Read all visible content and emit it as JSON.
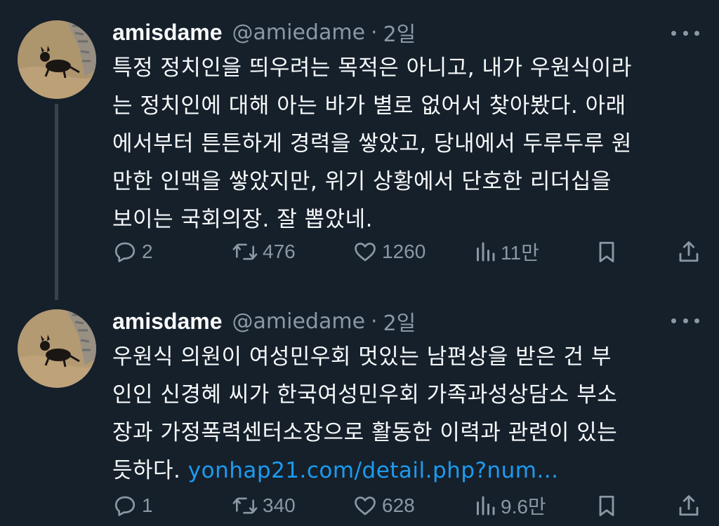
{
  "colors": {
    "background": "#15202b",
    "text": "#f7f9f9",
    "muted": "#8b98a5",
    "link": "#1d9bf0",
    "thread_line": "#38444d"
  },
  "icons": {
    "reply": "reply-icon",
    "retweet": "retweet-icon",
    "like": "heart-icon",
    "views": "views-icon",
    "bookmark": "bookmark-icon",
    "share": "share-icon",
    "more": "more-icon"
  },
  "tweets": [
    {
      "display_name": "amisdame",
      "handle": "@amiedame",
      "separator": "·",
      "timestamp": "2일",
      "body_lines": [
        "특정 정치인을 띄우려는 목적은 아니고, 내가 우원식이라",
        "는 정치인에 대해 아는 바가 별로 없어서 찾아봤다. 아래",
        "에서부터 튼튼하게 경력을 쌓았고, 당내에서 두루두루 원",
        "만한 인맥을 쌓았지만, 위기 상황에서 단호한 리더십을",
        "보이는 국회의장. 잘 뽑았네."
      ],
      "link": "",
      "stats": {
        "replies": "2",
        "retweets": "476",
        "likes": "1260",
        "views": "11만"
      }
    },
    {
      "display_name": "amisdame",
      "handle": "@amiedame",
      "separator": "·",
      "timestamp": "2일",
      "body_lines": [
        "우원식 의원이 여성민우회 멋있는 남편상을 받은 건 부",
        "인인 신경혜 씨가 한국여성민우회 가족과성상담소 부소",
        "장과 가정폭력센터소장으로 활동한 이력과 관련이 있는",
        "듯하다."
      ],
      "link": "yonhap21.com/detail.php?num...",
      "stats": {
        "replies": "1",
        "retweets": "340",
        "likes": "628",
        "views": "9.6만"
      }
    }
  ]
}
